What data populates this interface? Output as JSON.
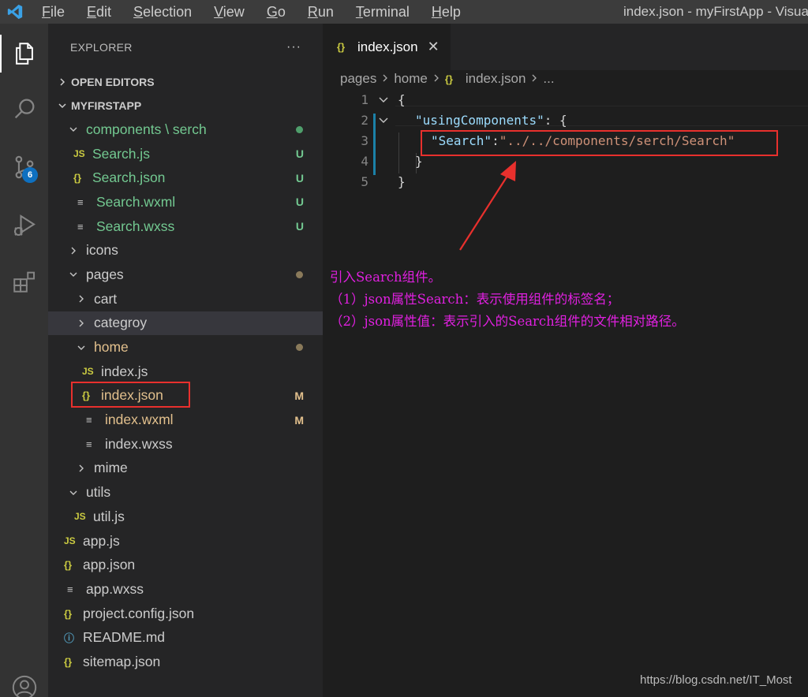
{
  "menu": {
    "items": [
      {
        "mnemonic": "F",
        "rest": "ile"
      },
      {
        "mnemonic": "E",
        "rest": "dit"
      },
      {
        "mnemonic": "S",
        "rest": "election"
      },
      {
        "mnemonic": "V",
        "rest": "iew"
      },
      {
        "mnemonic": "G",
        "rest": "o"
      },
      {
        "mnemonic": "R",
        "rest": "un"
      },
      {
        "mnemonic": "T",
        "rest": "erminal"
      },
      {
        "mnemonic": "H",
        "rest": "elp"
      }
    ]
  },
  "window_title": "index.json - myFirstApp - Visual",
  "activity": {
    "source_control_badge": "6",
    "icons": [
      "explorer-icon",
      "search-icon",
      "source-control-icon",
      "run-debug-icon",
      "extensions-icon",
      "account-icon"
    ]
  },
  "sidebar": {
    "title": "EXPLORER",
    "more": "···",
    "open_editors": "OPEN EDITORS",
    "project": "MYFIRSTAPP",
    "tree": [
      {
        "label": "components \\ serch",
        "type": "folder",
        "open": true,
        "color": "green",
        "status": "dot-green"
      },
      {
        "label": "Search.js",
        "type": "js",
        "color": "green",
        "status": "U"
      },
      {
        "label": "Search.json",
        "type": "json",
        "color": "green",
        "status": "U"
      },
      {
        "label": "Search.wxml",
        "type": "lines",
        "color": "green",
        "status": "U"
      },
      {
        "label": "Search.wxss",
        "type": "lines",
        "color": "green",
        "status": "U"
      },
      {
        "label": "icons",
        "type": "folder",
        "open": false,
        "color": "normal",
        "status": ""
      },
      {
        "label": "pages",
        "type": "folder",
        "open": true,
        "color": "normal",
        "status": "dot-gray"
      },
      {
        "label": "cart",
        "type": "folder",
        "open": false,
        "color": "normal",
        "status": ""
      },
      {
        "label": "categroy",
        "type": "folder",
        "open": false,
        "color": "normal",
        "status": ""
      },
      {
        "label": "home",
        "type": "folder",
        "open": true,
        "color": "orange",
        "status": "dot-gray"
      },
      {
        "label": "index.js",
        "type": "js",
        "color": "normal",
        "status": ""
      },
      {
        "label": "index.json",
        "type": "json",
        "color": "orange",
        "status": "M"
      },
      {
        "label": "index.wxml",
        "type": "lines",
        "color": "orange",
        "status": "M"
      },
      {
        "label": "index.wxss",
        "type": "lines",
        "color": "normal",
        "status": ""
      },
      {
        "label": "mime",
        "type": "folder",
        "open": false,
        "color": "normal",
        "status": ""
      },
      {
        "label": "utils",
        "type": "folder",
        "open": true,
        "color": "normal",
        "status": ""
      },
      {
        "label": "util.js",
        "type": "js",
        "color": "normal",
        "status": ""
      },
      {
        "label": "app.js",
        "type": "js",
        "color": "normal",
        "status": ""
      },
      {
        "label": "app.json",
        "type": "json",
        "color": "normal",
        "status": ""
      },
      {
        "label": "app.wxss",
        "type": "lines",
        "color": "normal",
        "status": ""
      },
      {
        "label": "project.config.json",
        "type": "json",
        "color": "normal",
        "status": ""
      },
      {
        "label": "README.md",
        "type": "info",
        "color": "normal",
        "status": ""
      },
      {
        "label": "sitemap.json",
        "type": "json",
        "color": "normal",
        "status": ""
      }
    ]
  },
  "editor": {
    "tab": {
      "label": "index.json",
      "close": "✕"
    },
    "breadcrumb": [
      "pages",
      "home",
      "index.json",
      "..."
    ],
    "lines": [
      {
        "n": "1",
        "text": "{"
      },
      {
        "n": "2",
        "key": "\"usingComponents\"",
        "rest": ": {"
      },
      {
        "n": "3",
        "key": "\"Search\"",
        "colon": ":",
        "value": "\"../../components/serch/Search\""
      },
      {
        "n": "4",
        "text": "}"
      },
      {
        "n": "5",
        "text": "}"
      }
    ]
  },
  "annotation": {
    "line1": "引入Search组件。",
    "line2": "（1）json属性Search：表示使用组件的标签名；",
    "line3": "（2）json属性值：表示引入的Search组件的文件相对路径。"
  },
  "watermark": "https://blog.csdn.net/IT_Most",
  "colors": {
    "accent": "#0e70c0",
    "annotation": "#e020e0",
    "highlight_box": "#e8302d",
    "git_untracked": "#73c991",
    "git_modified": "#e2c08d"
  }
}
